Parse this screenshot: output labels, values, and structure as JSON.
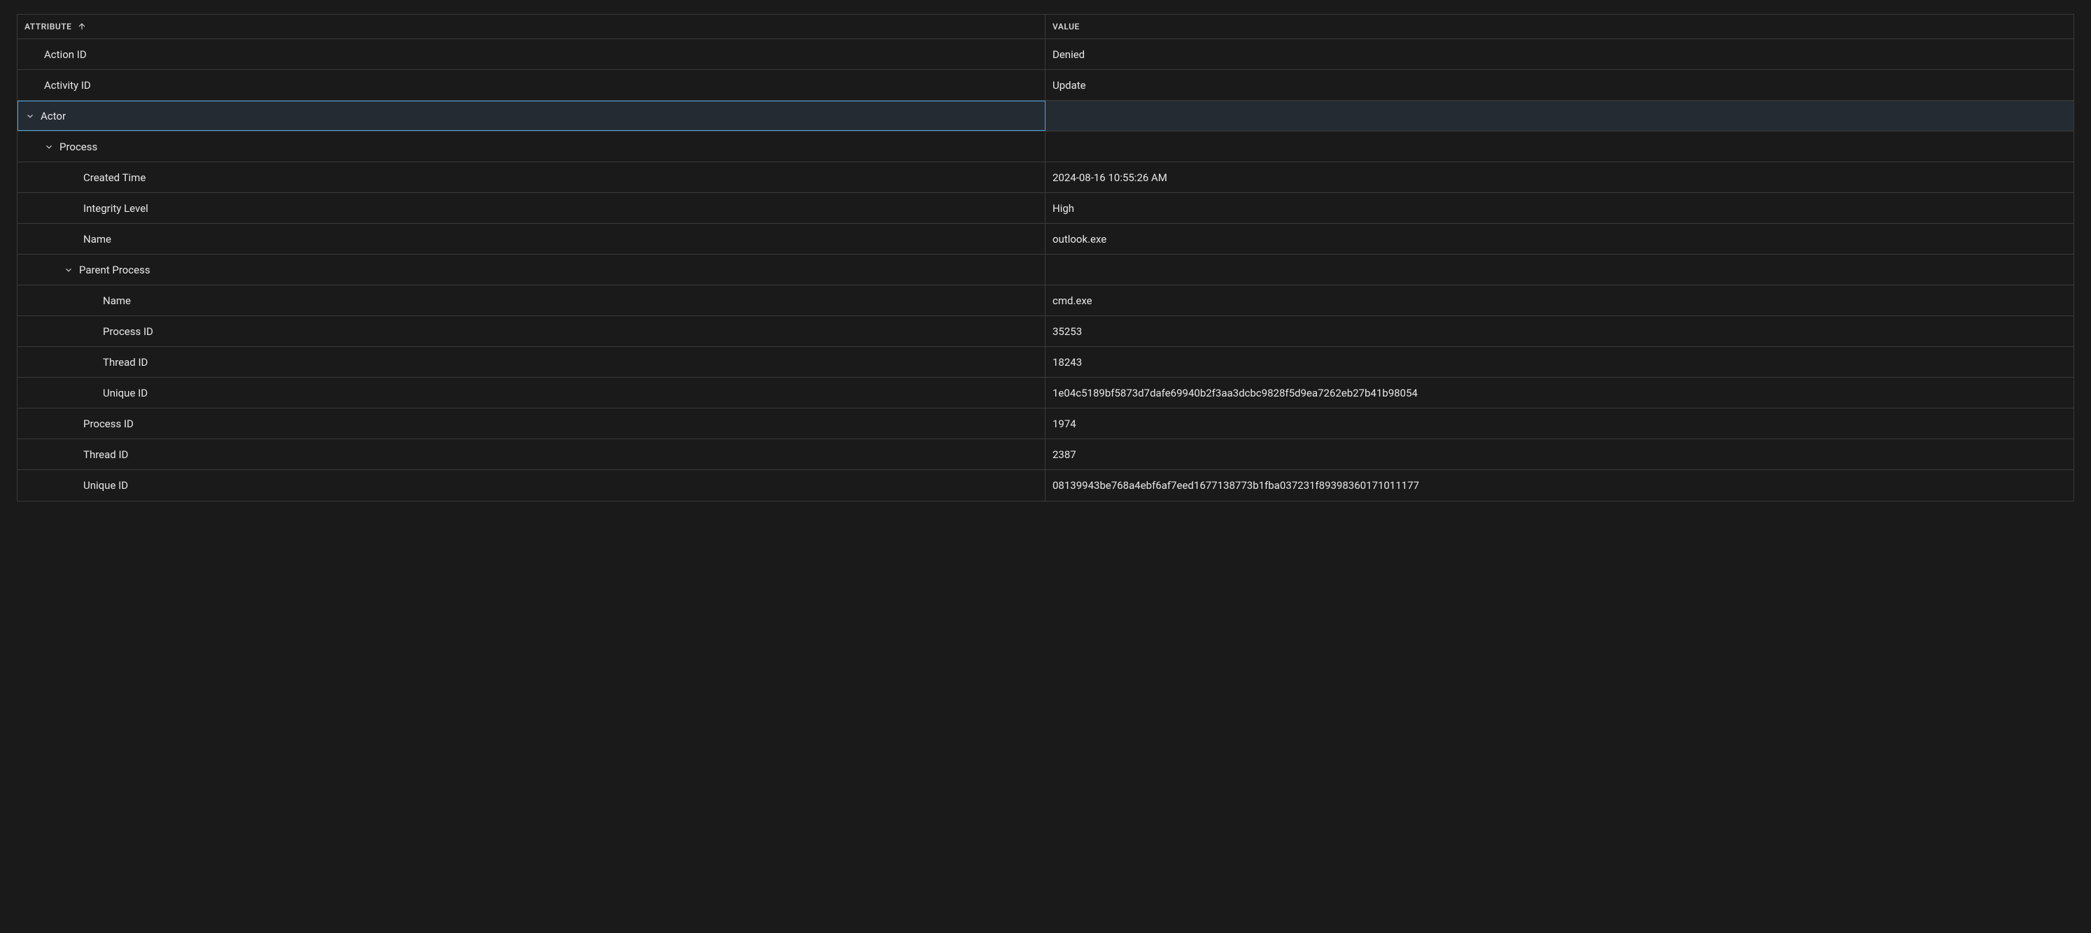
{
  "headers": {
    "attribute": "ATTRIBUTE",
    "value": "VALUE"
  },
  "rows": [
    {
      "attr": "Action ID",
      "value": "Denied",
      "indent": 1,
      "chevron": false,
      "selected": false
    },
    {
      "attr": "Activity ID",
      "value": "Update",
      "indent": 1,
      "chevron": false,
      "selected": false
    },
    {
      "attr": "Actor",
      "value": "",
      "indent": 1,
      "chevron": true,
      "selected": true
    },
    {
      "attr": "Process",
      "value": "",
      "indent": 2,
      "chevron": true,
      "selected": false
    },
    {
      "attr": "Created Time",
      "value": "2024-08-16 10:55:26 AM",
      "indent": 3,
      "chevron": false,
      "selected": false
    },
    {
      "attr": "Integrity Level",
      "value": "High",
      "indent": 3,
      "chevron": false,
      "selected": false
    },
    {
      "attr": "Name",
      "value": "outlook.exe",
      "indent": 3,
      "chevron": false,
      "selected": false
    },
    {
      "attr": "Parent Process",
      "value": "",
      "indent": 3,
      "chevron": true,
      "selected": false
    },
    {
      "attr": "Name",
      "value": "cmd.exe",
      "indent": 4,
      "chevron": false,
      "selected": false
    },
    {
      "attr": "Process ID",
      "value": "35253",
      "indent": 4,
      "chevron": false,
      "selected": false
    },
    {
      "attr": "Thread ID",
      "value": "18243",
      "indent": 4,
      "chevron": false,
      "selected": false
    },
    {
      "attr": "Unique ID",
      "value": "1e04c5189bf5873d7dafe69940b2f3aa3dcbc9828f5d9ea7262eb27b41b98054",
      "indent": 4,
      "chevron": false,
      "selected": false
    },
    {
      "attr": "Process ID",
      "value": "1974",
      "indent": 3,
      "chevron": false,
      "selected": false
    },
    {
      "attr": "Thread ID",
      "value": "2387",
      "indent": 3,
      "chevron": false,
      "selected": false
    },
    {
      "attr": "Unique ID",
      "value": "08139943be768a4ebf6af7eed1677138773b1fba037231f89398360171011177",
      "indent": 3,
      "chevron": false,
      "selected": false
    }
  ]
}
